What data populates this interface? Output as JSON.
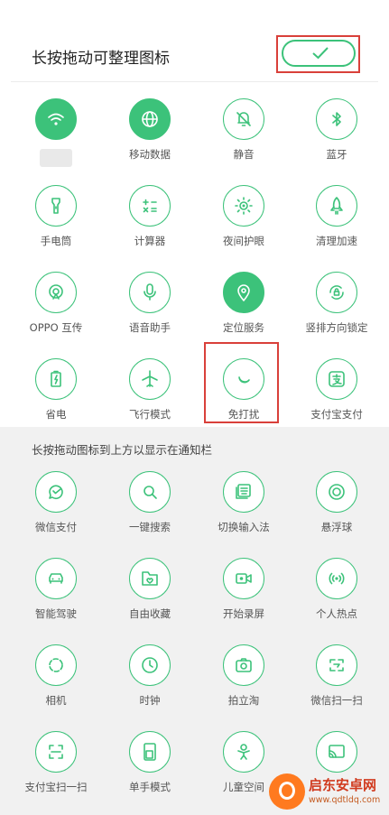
{
  "header": {
    "title": "长按拖动可整理图标"
  },
  "active_tiles": [
    {
      "label": "",
      "icon": "wifi-icon",
      "on": true
    },
    {
      "label": "移动数据",
      "icon": "globe-icon",
      "on": true
    },
    {
      "label": "静音",
      "icon": "bell-mute-icon",
      "on": false
    },
    {
      "label": "蓝牙",
      "icon": "bluetooth-icon",
      "on": false
    },
    {
      "label": "手电筒",
      "icon": "flashlight-icon",
      "on": false
    },
    {
      "label": "计算器",
      "icon": "calculator-icon",
      "on": false
    },
    {
      "label": "夜间护眼",
      "icon": "eye-sun-icon",
      "on": false
    },
    {
      "label": "清理加速",
      "icon": "rocket-icon",
      "on": false
    },
    {
      "label": "OPPO 互传",
      "icon": "transfer-icon",
      "on": false
    },
    {
      "label": "语音助手",
      "icon": "microphone-icon",
      "on": false
    },
    {
      "label": "定位服务",
      "icon": "location-pin-icon",
      "on": true
    },
    {
      "label": "竖排方向锁定",
      "icon": "rotation-lock-icon",
      "on": false
    },
    {
      "label": "省电",
      "icon": "battery-icon",
      "on": false
    },
    {
      "label": "飞行模式",
      "icon": "airplane-icon",
      "on": false
    },
    {
      "label": "免打扰",
      "icon": "moon-icon",
      "on": false
    },
    {
      "label": "支付宝支付",
      "icon": "alipay-icon",
      "on": false
    }
  ],
  "section_title": "长按拖动图标到上方以显示在通知栏",
  "available_tiles": [
    {
      "label": "微信支付",
      "icon": "wechat-pay-icon"
    },
    {
      "label": "一键搜索",
      "icon": "search-icon"
    },
    {
      "label": "切换输入法",
      "icon": "keyboard-icon"
    },
    {
      "label": "悬浮球",
      "icon": "floating-ball-icon"
    },
    {
      "label": "智能驾驶",
      "icon": "car-icon"
    },
    {
      "label": "自由收藏",
      "icon": "favorite-folder-icon"
    },
    {
      "label": "开始录屏",
      "icon": "screen-record-icon"
    },
    {
      "label": "个人热点",
      "icon": "hotspot-icon"
    },
    {
      "label": "相机",
      "icon": "camera-ring-icon"
    },
    {
      "label": "时钟",
      "icon": "clock-icon"
    },
    {
      "label": "拍立淘",
      "icon": "camera-icon"
    },
    {
      "label": "微信扫一扫",
      "icon": "wechat-scan-icon"
    },
    {
      "label": "支付宝扫一扫",
      "icon": "alipay-scan-icon"
    },
    {
      "label": "单手模式",
      "icon": "one-hand-icon"
    },
    {
      "label": "儿童空间",
      "icon": "child-icon"
    },
    {
      "label": "",
      "icon": "cast-icon"
    }
  ],
  "watermark": {
    "title": "启东安卓网",
    "url": "www.qdtldq.com"
  },
  "colors": {
    "accent": "#3cc27a",
    "highlight": "#d9403a",
    "panel": "#f1f1f1"
  }
}
